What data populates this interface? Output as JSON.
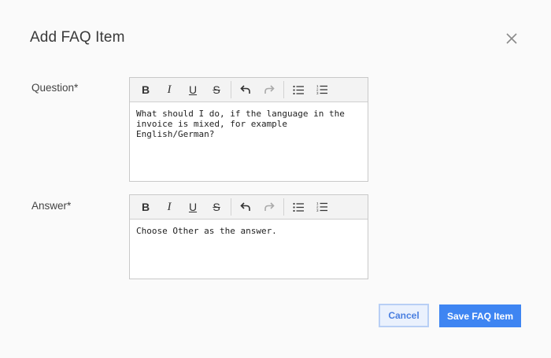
{
  "dialog": {
    "title": "Add FAQ Item",
    "close_icon": "close-icon"
  },
  "question": {
    "label": "Question*",
    "value": "What should I do, if the language in the invoice is mixed, for example English/German?"
  },
  "answer": {
    "label": "Answer*",
    "value": "Choose Other as the answer."
  },
  "toolbar": {
    "bold": "B",
    "italic": "I",
    "underline": "U",
    "strike": "S",
    "icons": [
      "bold-icon",
      "italic-icon",
      "underline-icon",
      "strikethrough-icon",
      "undo-icon",
      "redo-icon",
      "bullet-list-icon",
      "numbered-list-icon"
    ]
  },
  "actions": {
    "cancel_label": "Cancel",
    "save_label": "Save FAQ Item"
  },
  "colors": {
    "primary": "#3e85f2",
    "cancel_bg": "#eaf1fd",
    "cancel_text": "#4a7fe0"
  }
}
